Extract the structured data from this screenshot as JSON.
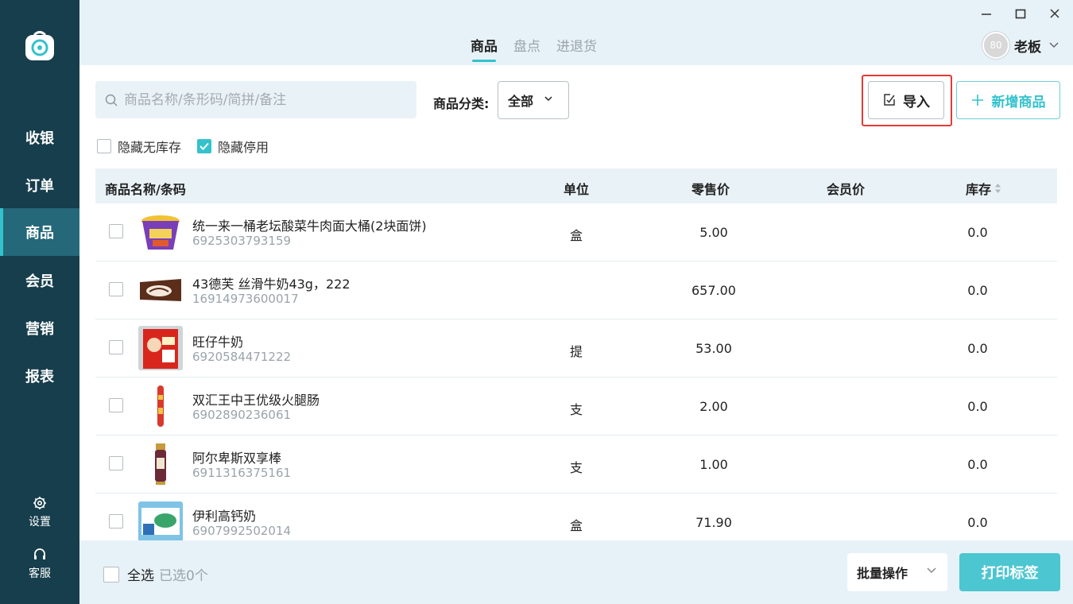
{
  "sidebar": {
    "items": [
      {
        "label": "收银"
      },
      {
        "label": "订单"
      },
      {
        "label": "商品"
      },
      {
        "label": "会员"
      },
      {
        "label": "营销"
      },
      {
        "label": "报表"
      }
    ],
    "active_index": 2,
    "settings_label": "设置",
    "service_label": "客服"
  },
  "header": {
    "tabs": [
      {
        "label": "商品"
      },
      {
        "label": "盘点"
      },
      {
        "label": "进退货"
      }
    ],
    "active_tab": 0,
    "user": {
      "avatar_text": "80",
      "name": "老板"
    }
  },
  "toolbar": {
    "search_placeholder": "商品名称/条形码/简拼/备注",
    "category_label": "商品分类:",
    "category_value": "全部",
    "import_label": "导入",
    "add_label": "新增商品"
  },
  "filters": {
    "hide_no_stock": {
      "label": "隐藏无库存",
      "checked": false
    },
    "hide_disabled": {
      "label": "隐藏停用",
      "checked": true
    }
  },
  "table": {
    "headers": {
      "name": "商品名称/条码",
      "unit": "单位",
      "retail": "零售价",
      "member": "会员价",
      "stock": "库存"
    },
    "rows": [
      {
        "name": "统一来一桶老坛酸菜牛肉面大桶(2块面饼)",
        "code": "6925303793159",
        "unit": "盒",
        "retail": "5.00",
        "member": "",
        "stock": "0.0",
        "thumb": "noodle-cup"
      },
      {
        "name": "43德芙 丝滑牛奶43g，222",
        "code": "16914973600017",
        "unit": "",
        "retail": "657.00",
        "member": "",
        "stock": "0.0",
        "thumb": "chocolate-bar"
      },
      {
        "name": "旺仔牛奶",
        "code": "6920584471222",
        "unit": "提",
        "retail": "53.00",
        "member": "",
        "stock": "0.0",
        "thumb": "milk-box"
      },
      {
        "name": "双汇王中王优级火腿肠",
        "code": "6902890236061",
        "unit": "支",
        "retail": "2.00",
        "member": "",
        "stock": "0.0",
        "thumb": "sausage"
      },
      {
        "name": "阿尔卑斯双享棒",
        "code": "6911316375161",
        "unit": "支",
        "retail": "1.00",
        "member": "",
        "stock": "0.0",
        "thumb": "candy-stick"
      },
      {
        "name": "伊利高钙奶",
        "code": "6907992502014",
        "unit": "盒",
        "retail": "71.90",
        "member": "",
        "stock": "0.0",
        "thumb": "milk-carton"
      }
    ]
  },
  "footer": {
    "select_all_label": "全选",
    "selected_count": "已选0个",
    "bulk_label": "批量操作",
    "print_label": "打印标签"
  },
  "colors": {
    "sidebar_bg": "#173e4c",
    "accent": "#33c2cc",
    "highlight": "#e53935"
  }
}
